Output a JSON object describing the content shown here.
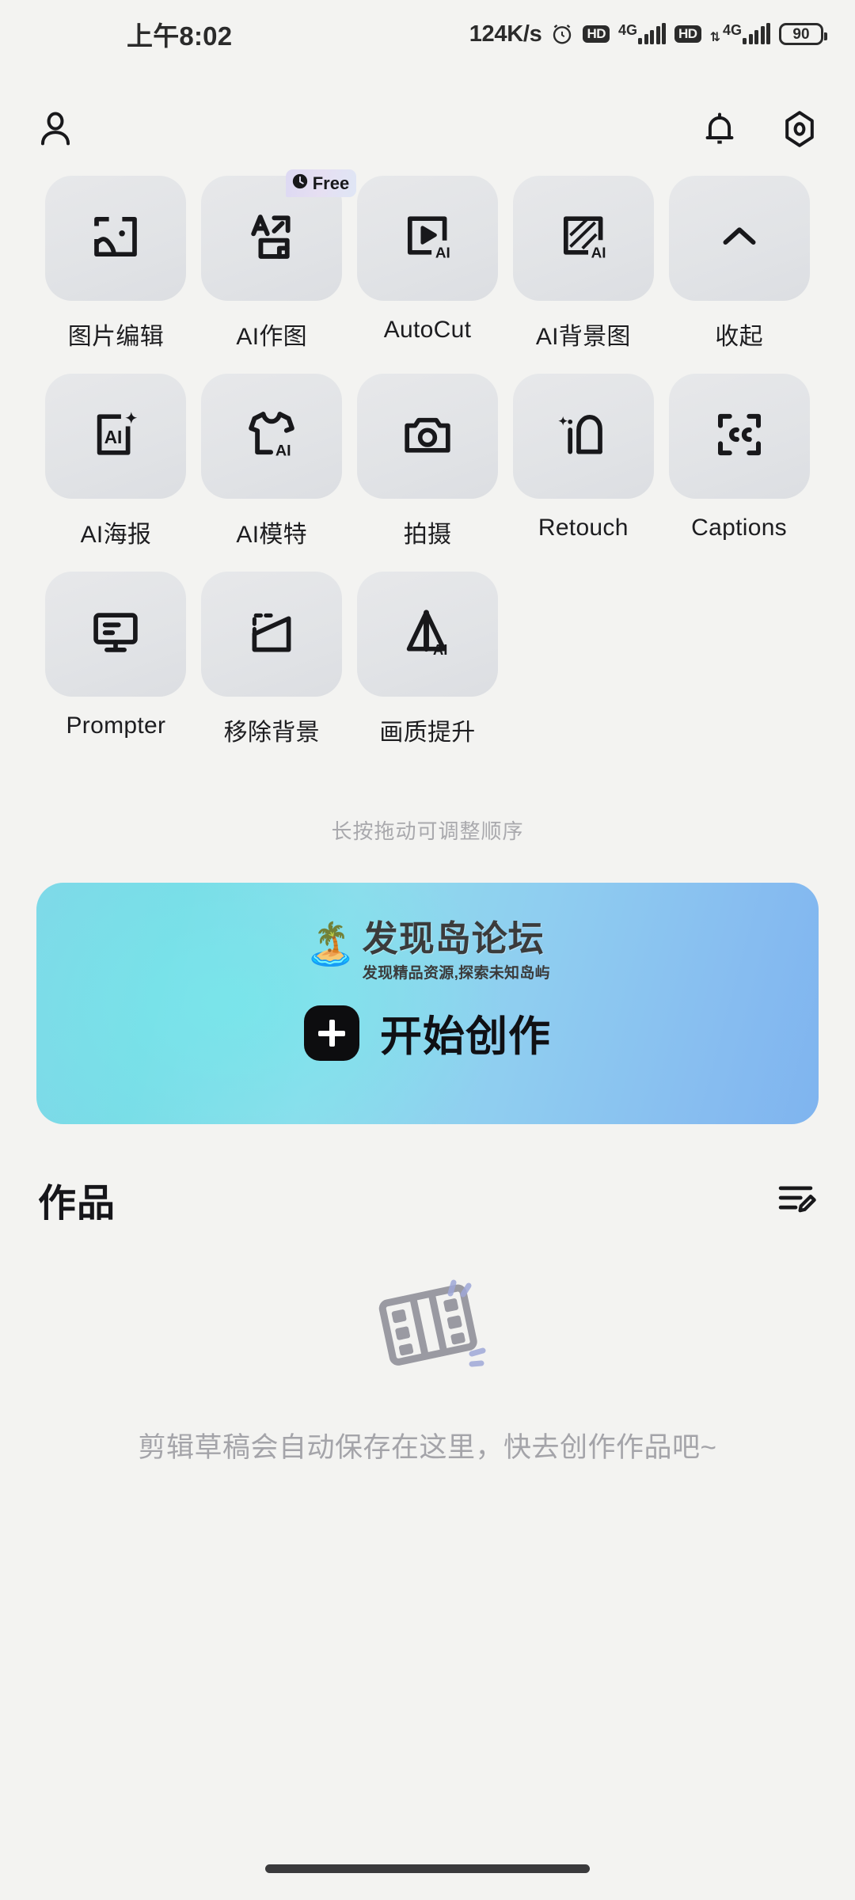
{
  "status_bar": {
    "time": "上午8:02",
    "network_speed": "124K/s",
    "alarm_icon": "alarm-clock-icon",
    "sim1_hd": "HD",
    "sim1_network": "4G",
    "sim2_hd": "HD",
    "sim2_network": "4G",
    "battery_level": "90"
  },
  "top_nav": {
    "profile_icon": "person-icon",
    "notification_icon": "bell-icon",
    "settings_icon": "settings-hexagon-icon"
  },
  "tools": {
    "hint": "长按拖动可调整顺序",
    "items": [
      {
        "label": "图片编辑",
        "icon": "image-edit-icon",
        "badge": null
      },
      {
        "label": "AI作图",
        "icon": "ai-text-to-image-icon",
        "badge": "Free"
      },
      {
        "label": "AutoCut",
        "icon": "autocut-video-ai-icon",
        "badge": null
      },
      {
        "label": "AI背景图",
        "icon": "ai-background-icon",
        "badge": null
      },
      {
        "label": "收起",
        "icon": "chevron-up-icon",
        "badge": null
      },
      {
        "label": "AI海报",
        "icon": "ai-poster-icon",
        "badge": null
      },
      {
        "label": "AI模特",
        "icon": "ai-model-tshirt-icon",
        "badge": null
      },
      {
        "label": "拍摄",
        "icon": "camera-icon",
        "badge": null
      },
      {
        "label": "Retouch",
        "icon": "retouch-face-icon",
        "badge": null
      },
      {
        "label": "Captions",
        "icon": "captions-cc-icon",
        "badge": null
      },
      {
        "label": "Prompter",
        "icon": "prompter-monitor-icon",
        "badge": null
      },
      {
        "label": "移除背景",
        "icon": "remove-background-icon",
        "badge": null
      },
      {
        "label": "画质提升",
        "icon": "quality-enhance-ai-icon",
        "badge": null
      }
    ]
  },
  "banner": {
    "watermark_title": "发现岛论坛",
    "watermark_subtitle": "发现精品资源,探索未知岛屿",
    "watermark_emoji": "🏝️",
    "cta_label": "开始创作",
    "plus_icon": "plus-icon",
    "gradient_start": "#7fd8e8",
    "gradient_end": "#7fb4ef"
  },
  "works": {
    "title": "作品",
    "manage_icon": "edit-list-icon",
    "empty_icon": "film-strip-icon",
    "empty_text": "剪辑草稿会自动保存在这里，快去创作作品吧~"
  },
  "system": {
    "home_indicator": "home-indicator"
  }
}
